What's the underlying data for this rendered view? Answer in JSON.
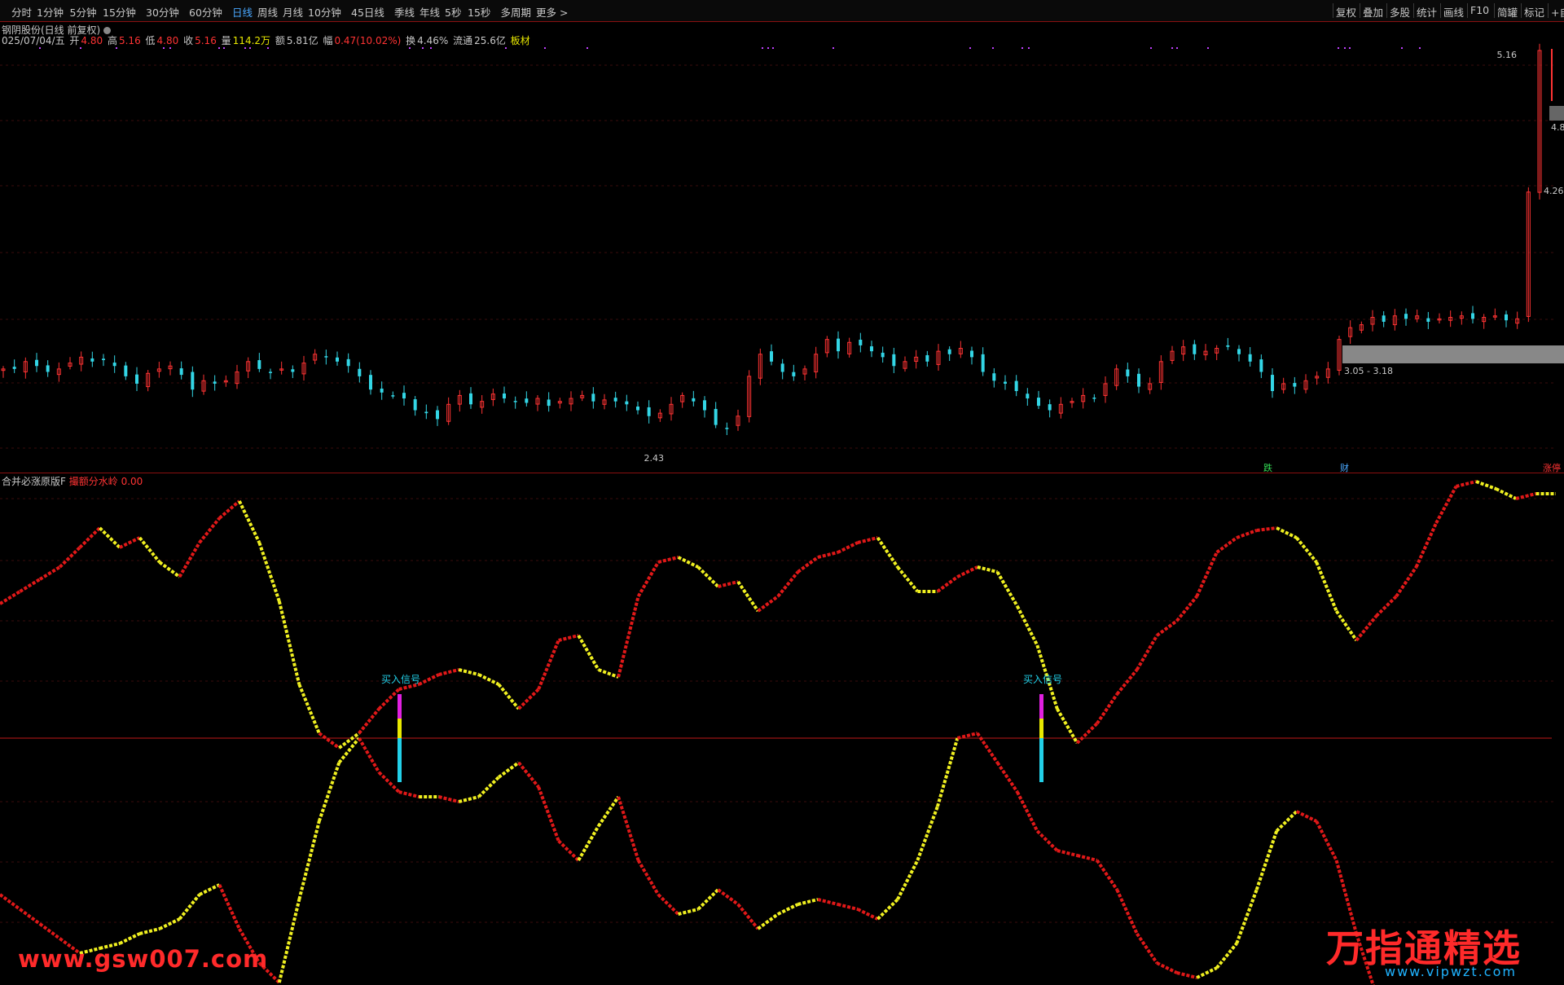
{
  "toolbar": {
    "periods": [
      "分时",
      "1分钟",
      "5分钟",
      "15分钟",
      "30分钟",
      "60分钟",
      "日线",
      "周线",
      "月线",
      "10分钟",
      "45日线",
      "季线",
      "年线",
      "5秒",
      "15秒",
      "多周期",
      "更多 >"
    ],
    "active_period": "日线",
    "right_tools": [
      "复权",
      "叠加",
      "多股",
      "统计",
      "画线",
      "F10",
      "简罐",
      "标记",
      "+自"
    ]
  },
  "stock": {
    "name_line": "钢阴股份(日线 前复权)",
    "date": "025/07/04/五",
    "open_label": "开",
    "open": "4.80",
    "high_label": "高",
    "high": "5.16",
    "low_label": "低",
    "low": "4.80",
    "close_label": "收",
    "close": "5.16",
    "volume_label": "量",
    "volume": "114.2万",
    "amount_label": "额",
    "amount": "5.81亿",
    "change_label": "幅",
    "change": "0.47(10.02%)",
    "turnover_label": "换",
    "turnover": "4.46%",
    "float_label": "流通",
    "float": "25.6亿",
    "sector": "板材"
  },
  "price_chart": {
    "price_labels": {
      "high": "5.16",
      "r1": "4.8",
      "r2": "4.26",
      "low": "2.43"
    },
    "zone_label": "3.05 - 3.18",
    "event_markers": [
      "跌",
      "财",
      "涨停"
    ],
    "colors": {
      "up": "#ff3333",
      "down": "#33d6e6",
      "zone": "#888888"
    }
  },
  "indicator": {
    "name": "合并必涨原版F",
    "param_label": "撮额分水岭",
    "param_value": "0.00",
    "buy_signal_label": "买入信号"
  },
  "watermarks": {
    "left": "www.gsw007.com",
    "right": "万指通精选",
    "url": "www.vipwzt.com"
  },
  "chart_data": {
    "type": "line",
    "series": [
      {
        "name": "price",
        "values": [
          3.0,
          3.0,
          3.05,
          3.02,
          2.98,
          3.0,
          3.04,
          3.08,
          3.05,
          3.06,
          3.02,
          2.95,
          2.9,
          2.97,
          3.0,
          3.02,
          2.96,
          2.86,
          2.92,
          2.9,
          2.92,
          2.98,
          3.05,
          3.0,
          2.98,
          3.0,
          2.98,
          3.04,
          3.1,
          3.08,
          3.05,
          3.02,
          2.95,
          2.86,
          2.84,
          2.82,
          2.8,
          2.72,
          2.7,
          2.66,
          2.76,
          2.82,
          2.76,
          2.78,
          2.83,
          2.8,
          2.78,
          2.77,
          2.8,
          2.75,
          2.78,
          2.8,
          2.82,
          2.78,
          2.79,
          2.78,
          2.76,
          2.72,
          2.68,
          2.7,
          2.76,
          2.82,
          2.78,
          2.72,
          2.62,
          2.6,
          2.68,
          2.95,
          3.1,
          3.05,
          2.98,
          2.95,
          3.0,
          3.1,
          3.2,
          3.12,
          3.18,
          3.16,
          3.12,
          3.08,
          3.02,
          3.05,
          3.08,
          3.05,
          3.12,
          3.1,
          3.14,
          3.08,
          2.98,
          2.92,
          2.9,
          2.85,
          2.8,
          2.75,
          2.72,
          2.76,
          2.78,
          2.82,
          2.8,
          2.9,
          3.0,
          2.95,
          2.88,
          2.9,
          3.05,
          3.12,
          3.15,
          3.1,
          3.12,
          3.14,
          3.15,
          3.1,
          3.05,
          2.98,
          2.85,
          2.9,
          2.88,
          2.92,
          2.95,
          3.0,
          3.2,
          3.28,
          3.3,
          3.35,
          3.32,
          3.36,
          3.34,
          3.36,
          3.32,
          3.34,
          3.35,
          3.36,
          3.34,
          3.35,
          3.36,
          3.33,
          3.34,
          4.2,
          5.16
        ]
      },
      {
        "name": "upper",
        "values": [
          0.55,
          0.6,
          0.65,
          0.7,
          0.78,
          0.86,
          0.78,
          0.82,
          0.72,
          0.66,
          0.8,
          0.9,
          0.97,
          0.8,
          0.56,
          0.22,
          0.02,
          -0.04,
          0.02,
          0.12,
          0.2,
          0.22,
          0.26,
          0.28,
          0.26,
          0.22,
          0.12,
          0.2,
          0.4,
          0.42,
          0.28,
          0.25,
          0.58,
          0.72,
          0.74,
          0.7,
          0.62,
          0.64,
          0.52,
          0.58,
          0.68,
          0.74,
          0.76,
          0.8,
          0.82,
          0.7,
          0.6,
          0.6,
          0.66,
          0.7,
          0.68,
          0.54,
          0.38,
          0.12,
          -0.02,
          0.06,
          0.18,
          0.28,
          0.42,
          0.48,
          0.58,
          0.76,
          0.82,
          0.85,
          0.86,
          0.82,
          0.72,
          0.52,
          0.4,
          0.5,
          0.58,
          0.7,
          0.88,
          1.03,
          1.05,
          1.02,
          0.98,
          1.0,
          1.0
        ]
      },
      {
        "name": "lower",
        "values": [
          -0.64,
          -0.7,
          -0.76,
          -0.82,
          -0.88,
          -0.86,
          -0.84,
          -0.8,
          -0.78,
          -0.74,
          -0.64,
          -0.6,
          -0.78,
          -0.92,
          -1.0,
          -0.66,
          -0.34,
          -0.1,
          0.0,
          -0.14,
          -0.22,
          -0.24,
          -0.24,
          -0.26,
          -0.24,
          -0.16,
          -0.1,
          -0.2,
          -0.42,
          -0.5,
          -0.36,
          -0.24,
          -0.5,
          -0.64,
          -0.72,
          -0.7,
          -0.62,
          -0.68,
          -0.78,
          -0.72,
          -0.68,
          -0.66,
          -0.68,
          -0.7,
          -0.74,
          -0.66,
          -0.5,
          -0.28,
          0.0,
          0.02,
          -0.1,
          -0.22,
          -0.38,
          -0.46,
          -0.48,
          -0.5,
          -0.62,
          -0.8,
          -0.92,
          -0.96,
          -0.98,
          -0.94,
          -0.84,
          -0.62,
          -0.38,
          -0.3,
          -0.34,
          -0.5,
          -0.8,
          -1.05,
          -1.1,
          -1.12,
          -1.14,
          -1.16,
          -1.15,
          -1.14,
          -1.15,
          -1.16,
          -1.16
        ]
      }
    ],
    "buy_signals": [
      "买入信号",
      "买入信号"
    ],
    "price_range": [
      2.43,
      5.16
    ]
  }
}
